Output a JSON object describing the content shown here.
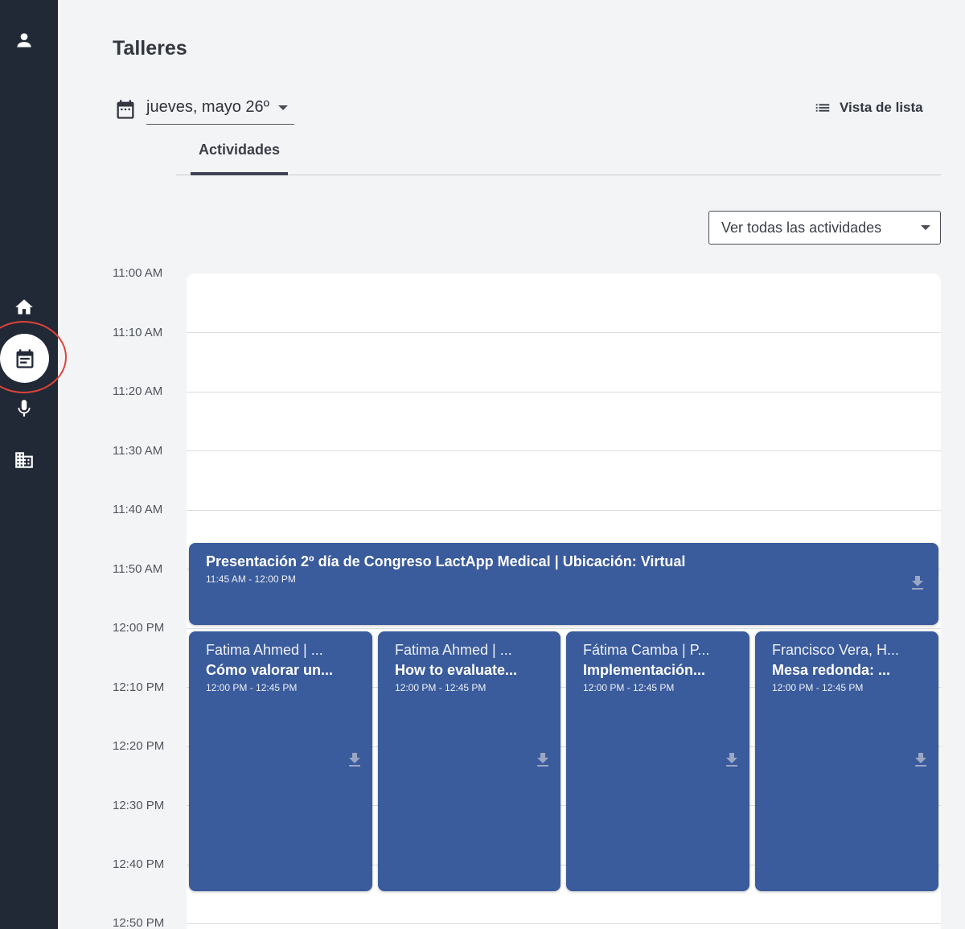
{
  "sidebar": {
    "items": [
      {
        "icon": "user-icon"
      },
      {
        "icon": "home-icon"
      },
      {
        "icon": "calendar-icon",
        "active": true
      },
      {
        "icon": "microphone-icon"
      },
      {
        "icon": "building-icon"
      }
    ]
  },
  "header": {
    "title": "Talleres",
    "date": "jueves, mayo 26º",
    "list_view": "Vista de lista"
  },
  "tabs": [
    {
      "label": "Actividades",
      "active": true
    }
  ],
  "filter": {
    "selected": "Ver todas las actividades"
  },
  "times": [
    "11:00 AM",
    "11:10 AM",
    "11:20 AM",
    "11:30 AM",
    "11:40 AM",
    "11:50 AM",
    "12:00 PM",
    "12:10 PM",
    "12:20 PM",
    "12:30 PM",
    "12:40 PM",
    "12:50 PM"
  ],
  "events": {
    "main": {
      "title": "Presentación 2º día de Congreso LactApp Medical | Ubicación: Virtual",
      "time": "11:45 AM - 12:00 PM"
    },
    "sessions": [
      {
        "speaker": "Fatima Ahmed | ...",
        "title": "Cómo valorar un...",
        "time": "12:00 PM - 12:45 PM"
      },
      {
        "speaker": "Fatima Ahmed | ...",
        "title": "How to evaluate...",
        "time": "12:00 PM - 12:45 PM"
      },
      {
        "speaker": "Fátima Camba | P...",
        "title": "Implementación...",
        "time": "12:00 PM - 12:45 PM"
      },
      {
        "speaker": "Francisco Vera, H...",
        "title": "Mesa redonda: ...",
        "time": "12:00 PM - 12:45 PM"
      }
    ]
  },
  "colors": {
    "sidebar": "#222936",
    "event": "#3a5b9c",
    "highlight": "#dd4338"
  }
}
